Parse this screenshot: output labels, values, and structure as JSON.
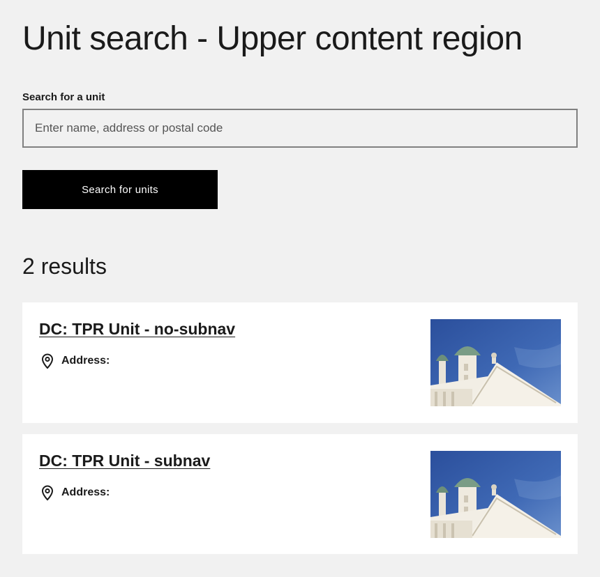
{
  "page": {
    "title": "Unit search - Upper content region"
  },
  "search": {
    "label": "Search for a unit",
    "placeholder": "Enter name, address or postal code",
    "value": "",
    "button_label": "Search for units"
  },
  "results": {
    "count_label": "2 results",
    "items": [
      {
        "title": "DC: TPR Unit - no-subnav",
        "address_label": "Address:",
        "icon": "location-pin-icon",
        "image_alt": "Helsinki Cathedral against blue sky"
      },
      {
        "title": "DC: TPR Unit - subnav",
        "address_label": "Address:",
        "icon": "location-pin-icon",
        "image_alt": "Helsinki Cathedral against blue sky"
      }
    ]
  },
  "colors": {
    "background": "#f1f1f1",
    "card": "#ffffff",
    "button": "#000000",
    "text": "#1a1a1a",
    "sky": "#3a64b0"
  }
}
